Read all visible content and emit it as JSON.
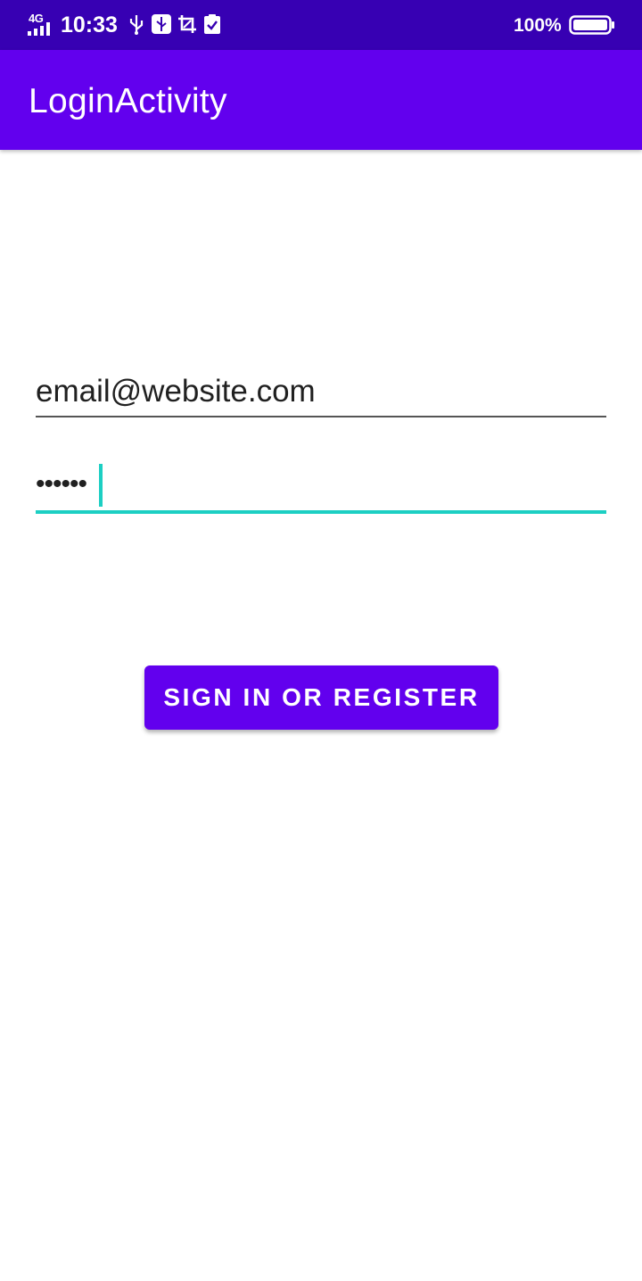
{
  "status_bar": {
    "network": "4G",
    "time": "10:33",
    "battery_percent": "100%",
    "battery_level": 1.0,
    "icons": [
      "signal-icon",
      "usb-icon",
      "usb-debug-icon",
      "screenshot-icon",
      "clipboard-check-icon",
      "battery-icon"
    ]
  },
  "app_bar": {
    "title": "LoginActivity",
    "color": "#6200ee"
  },
  "form": {
    "email_value": "email@website.com",
    "password_value": "••••••",
    "focus_color": "#1ccfc3"
  },
  "primary_button": {
    "label": "SIGN IN OR REGISTER",
    "color": "#6200ee"
  }
}
